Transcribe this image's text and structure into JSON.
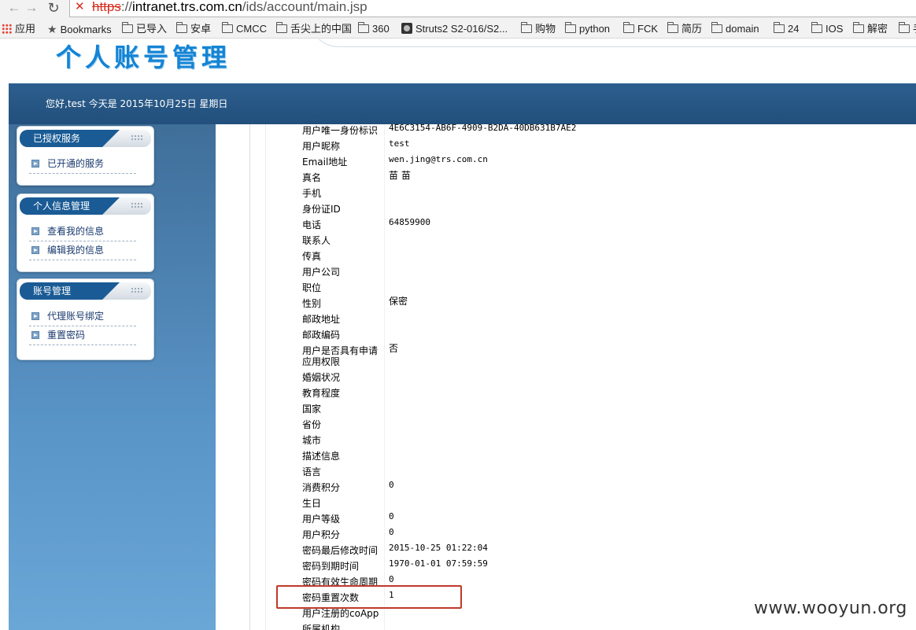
{
  "browser": {
    "url_scheme": "https",
    "url_sep": "://",
    "url_host": "intranet.trs.com.cn",
    "url_path": "/ids/account/main.jsp",
    "bookmarks": [
      {
        "label": "应用",
        "kind": "apps"
      },
      {
        "label": "Bookmarks",
        "kind": "star"
      },
      {
        "label": "已导入",
        "kind": "folder"
      },
      {
        "label": "安卓",
        "kind": "folder"
      },
      {
        "label": "CMCC",
        "kind": "folder"
      },
      {
        "label": "舌尖上的中国",
        "kind": "folder"
      },
      {
        "label": "360",
        "kind": "folder"
      },
      {
        "label": "Struts2 S2-016/S2...",
        "kind": "page"
      },
      {
        "label": "购物",
        "kind": "folder"
      },
      {
        "label": "python",
        "kind": "folder"
      },
      {
        "label": "FCK",
        "kind": "folder"
      },
      {
        "label": "简历",
        "kind": "folder"
      },
      {
        "label": "domain",
        "kind": "folder"
      },
      {
        "label": "24",
        "kind": "folder"
      },
      {
        "label": "IOS",
        "kind": "folder"
      },
      {
        "label": "解密",
        "kind": "folder"
      },
      {
        "label": "手",
        "kind": "folder"
      }
    ]
  },
  "header": {
    "title": "个人账号管理",
    "greeting_prefix": "您好,test ",
    "greeting_date": "今天是 2015年10月25日 星期日"
  },
  "sidebar": {
    "boxes": [
      {
        "title": "已授权服务",
        "items": [
          "已开通的服务"
        ]
      },
      {
        "title": "个人信息管理",
        "items": [
          "查看我的信息",
          "编辑我的信息"
        ]
      },
      {
        "title": "账号管理",
        "items": [
          "代理账号绑定",
          "重置密码"
        ]
      }
    ]
  },
  "info": {
    "rows": [
      {
        "label": "用户唯一身份标识",
        "value": "4E6C3154-AB6F-4909-B2DA-40DB631B7AE2"
      },
      {
        "label": "用户昵称",
        "value": "test"
      },
      {
        "label": "Email地址",
        "value": "wen.jing@trs.com.cn"
      },
      {
        "label": "真名",
        "value": "苗 苗"
      },
      {
        "label": "手机",
        "value": ""
      },
      {
        "label": "身份证ID",
        "value": ""
      },
      {
        "label": "电话",
        "value": "64859900"
      },
      {
        "label": "联系人",
        "value": ""
      },
      {
        "label": "传真",
        "value": ""
      },
      {
        "label": "用户公司",
        "value": ""
      },
      {
        "label": "职位",
        "value": ""
      },
      {
        "label": "性别",
        "value": "保密"
      },
      {
        "label": "邮政地址",
        "value": ""
      },
      {
        "label": "邮政编码",
        "value": ""
      },
      {
        "label": "用户是否具有申请",
        "label2": "应用权限",
        "value": "否"
      },
      {
        "label": "婚姻状况",
        "value": ""
      },
      {
        "label": "教育程度",
        "value": ""
      },
      {
        "label": "国家",
        "value": ""
      },
      {
        "label": "省份",
        "value": ""
      },
      {
        "label": "城市",
        "value": ""
      },
      {
        "label": "描述信息",
        "value": ""
      },
      {
        "label": "语言",
        "value": ""
      },
      {
        "label": "消费积分",
        "value": "0"
      },
      {
        "label": "生日",
        "value": ""
      },
      {
        "label": "用户等级",
        "value": "0"
      },
      {
        "label": "用户积分",
        "value": "0"
      },
      {
        "label": "密码最后修改时间",
        "value": "2015-10-25 01:22:04"
      },
      {
        "label": "密码到期时间",
        "value": "1970-01-01 07:59:59"
      },
      {
        "label": "密码有效生命周期",
        "value": "0"
      },
      {
        "label": "密码重置次数",
        "value": "1"
      },
      {
        "label": "用户注册的coApp",
        "value": ""
      },
      {
        "label": "所属机构",
        "value": ""
      }
    ]
  },
  "watermark": "www.wooyun.org",
  "colors": {
    "title_blue": "#1484d4",
    "band_blue": "#2d5f8e",
    "tab_blue": "#1a5b95",
    "highlight_red": "#c0392b"
  }
}
